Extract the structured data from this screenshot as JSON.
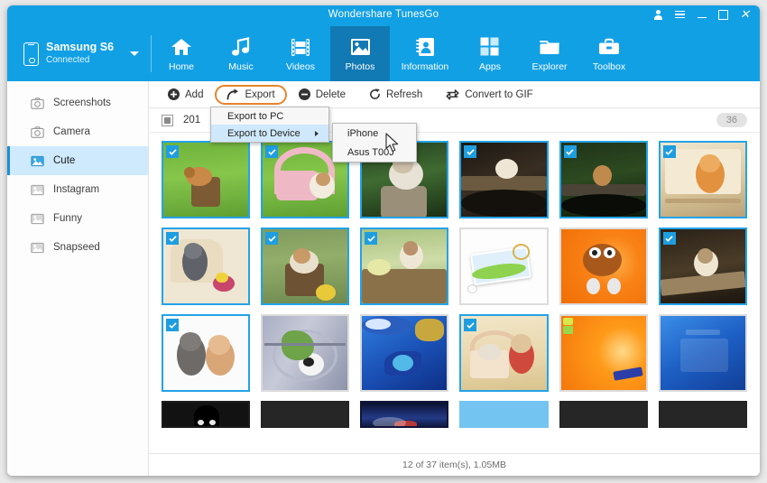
{
  "window": {
    "title": "Wondershare TunesGo",
    "controls": [
      {
        "name": "account-icon",
        "label": "account"
      },
      {
        "name": "menu-icon",
        "label": "menu"
      },
      {
        "name": "minimize-button",
        "label": "minimize"
      },
      {
        "name": "maximize-button",
        "label": "maximize"
      },
      {
        "name": "close-button",
        "label": "×"
      }
    ],
    "accent_color": "#12a0e5",
    "active_tab_color": "#1179b3",
    "selection_color": "#23a3e8",
    "highlight_ring_color": "#e8832a"
  },
  "device": {
    "name": "Samsung S6",
    "status": "Connected",
    "icon": "phone-icon",
    "dropdown_icon": "chevron-down-icon"
  },
  "nav": {
    "tabs": [
      {
        "label": "Home",
        "icon": "home-icon",
        "active": false
      },
      {
        "label": "Music",
        "icon": "music-icon",
        "active": false
      },
      {
        "label": "Videos",
        "icon": "video-icon",
        "active": false
      },
      {
        "label": "Photos",
        "icon": "photo-icon",
        "active": true
      },
      {
        "label": "Information",
        "icon": "contacts-icon",
        "active": false
      },
      {
        "label": "Apps",
        "icon": "apps-icon",
        "active": false
      },
      {
        "label": "Explorer",
        "icon": "folder-icon",
        "active": false
      },
      {
        "label": "Toolbox",
        "icon": "toolbox-icon",
        "active": false
      }
    ]
  },
  "sidebar": {
    "items": [
      {
        "label": "Screenshots",
        "icon": "camera-icon",
        "active": false
      },
      {
        "label": "Camera",
        "icon": "camera-icon",
        "active": false
      },
      {
        "label": "Cute",
        "icon": "album-icon",
        "active": true
      },
      {
        "label": "Instagram",
        "icon": "album-icon",
        "active": false
      },
      {
        "label": "Funny",
        "icon": "album-icon",
        "active": false
      },
      {
        "label": "Snapseed",
        "icon": "album-icon",
        "active": false
      }
    ]
  },
  "toolbar": {
    "buttons": [
      {
        "label": "Add",
        "icon": "plus-circle-icon",
        "highlighted": false
      },
      {
        "label": "Export",
        "icon": "export-arrow-icon",
        "highlighted": true
      },
      {
        "label": "Delete",
        "icon": "minus-circle-icon",
        "highlighted": false
      },
      {
        "label": "Refresh",
        "icon": "refresh-icon",
        "highlighted": false
      },
      {
        "label": "Convert to GIF",
        "icon": "convert-gif-icon",
        "highlighted": false
      }
    ]
  },
  "export_menu": {
    "items": [
      {
        "label": "Export to PC",
        "has_submenu": false,
        "highlighted": false
      },
      {
        "label": "Export to Device",
        "has_submenu": true,
        "highlighted": true
      }
    ],
    "submenu": {
      "items": [
        {
          "label": "iPhone",
          "highlighted": false
        },
        {
          "label": "Asus T00J",
          "highlighted": false
        }
      ]
    }
  },
  "group_header": {
    "date": "201",
    "count_badge": "36",
    "checkbox_state": "partial"
  },
  "status_bar": {
    "text": "12 of 37 item(s), 1.05MB"
  },
  "grid": {
    "items": [
      {
        "name": "puppy-in-bucket-on-grass",
        "selected": true,
        "art": "grass-pup"
      },
      {
        "name": "kitten-with-pink-basket",
        "selected": true,
        "art": "basket-kitten"
      },
      {
        "name": "kitten-on-tree-stump",
        "selected": true,
        "art": "stump-kitten"
      },
      {
        "name": "puppy-on-dark-bridge",
        "selected": true,
        "art": "dark-bridge"
      },
      {
        "name": "puppy-on-dark-log",
        "selected": true,
        "art": "dark-log"
      },
      {
        "name": "orange-kitten-on-wicker-chair",
        "selected": true,
        "art": "wicker-kitten"
      },
      {
        "name": "grey-cat-on-wicker-chair",
        "selected": true,
        "art": "grey-cat-chair"
      },
      {
        "name": "puppy-in-wooden-barrel",
        "selected": true,
        "art": "barrel-pup"
      },
      {
        "name": "kitten-in-planter-box",
        "selected": true,
        "art": "planter-kitten"
      },
      {
        "name": "windows-keycard-wallpaper",
        "selected": false,
        "art": "keycard"
      },
      {
        "name": "mm-character-wallpaper",
        "selected": false,
        "art": "mm-orange"
      },
      {
        "name": "kitten-on-wooden-beam",
        "selected": true,
        "art": "beam-kitten"
      },
      {
        "name": "two-kittens-portrait",
        "selected": true,
        "art": "two-kittens"
      },
      {
        "name": "windows-xp-soccer-wallpaper",
        "selected": false,
        "art": "xp-soccer"
      },
      {
        "name": "blue-butterfly-wallpaper",
        "selected": false,
        "art": "blue-butterfly"
      },
      {
        "name": "kittens-in-basket",
        "selected": true,
        "art": "basket-pair"
      },
      {
        "name": "orange-winxp-wallpaper",
        "selected": false,
        "art": "orange-xp"
      },
      {
        "name": "windows-xp-blue-wallpaper",
        "selected": false,
        "art": "blue-xp"
      },
      {
        "name": "dark-wallpaper-a",
        "selected": false,
        "art": "dark-face"
      },
      {
        "name": "dark-wallpaper-b",
        "selected": false,
        "art": "dark-plain"
      },
      {
        "name": "night-sky-wallpaper",
        "selected": false,
        "art": "night-sky"
      },
      {
        "name": "light-blue-wallpaper",
        "selected": false,
        "art": "sky-blue"
      },
      {
        "name": "dark-wallpaper-c",
        "selected": false,
        "art": "dark-plain"
      },
      {
        "name": "dark-wallpaper-d",
        "selected": false,
        "art": "dark-plain"
      }
    ]
  }
}
